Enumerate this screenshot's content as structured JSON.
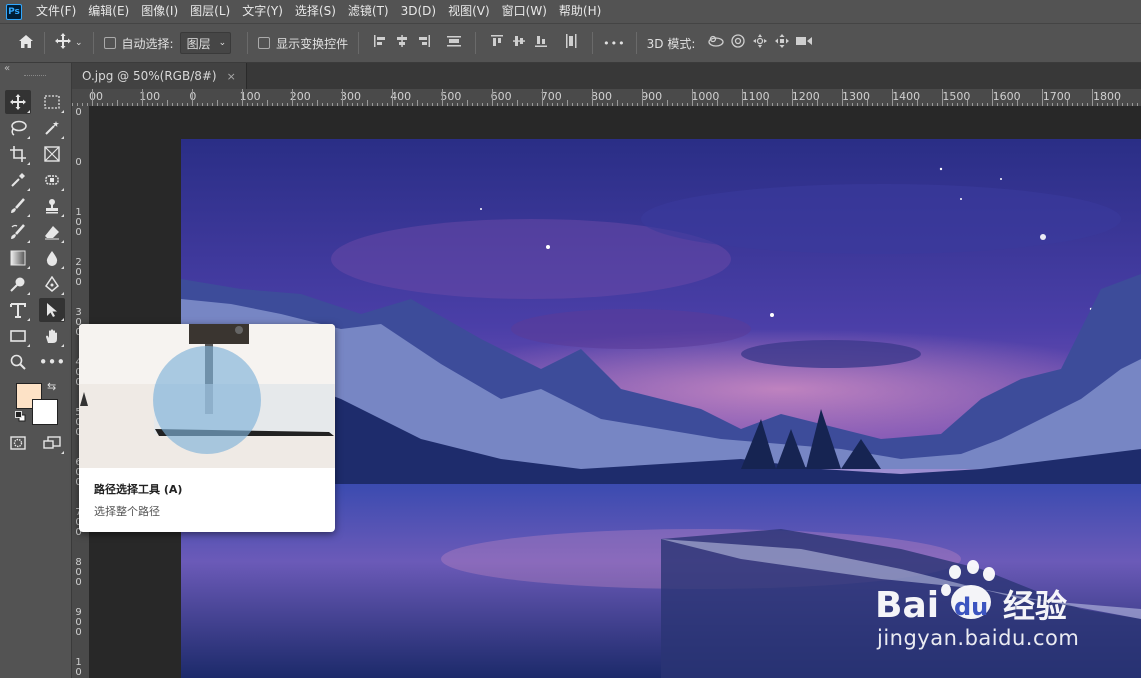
{
  "app": {
    "logo_text": "Ps"
  },
  "menu": [
    "文件(F)",
    "编辑(E)",
    "图像(I)",
    "图层(L)",
    "文字(Y)",
    "选择(S)",
    "滤镜(T)",
    "3D(D)",
    "视图(V)",
    "窗口(W)",
    "帮助(H)"
  ],
  "options": {
    "auto_select_label": "自动选择:",
    "auto_select_target": "图层",
    "show_transform_label": "显示变换控件",
    "more_label": "•••",
    "mode_3d_label": "3D 模式:"
  },
  "document_tab": {
    "title": "O.jpg @ 50%(RGB/8#)",
    "close": "×"
  },
  "toolbox": {
    "collapse": "«",
    "more_tools": "•••"
  },
  "ruler": {
    "h_labels": [
      "00",
      "100",
      "0",
      "100",
      "200",
      "300",
      "400",
      "500",
      "600",
      "700",
      "800",
      "900",
      "1000",
      "1100",
      "1200",
      "1300",
      "1400",
      "1500",
      "1600",
      "1700",
      "1800",
      "1"
    ],
    "v_labels": [
      "0",
      "0",
      "1 0 0",
      "2 0 0",
      "3 0 0",
      "4 0 0",
      "5 0 0",
      "6 0 0",
      "7 0 0",
      "8 0 0",
      "9 0 0",
      "1 0 0"
    ]
  },
  "tooltip": {
    "title": "路径选择工具 (A)",
    "description": "选择整个路径"
  },
  "watermark": {
    "logo_text": "Bai",
    "logo_text2": "du",
    "logo_text3": "经验",
    "url": "jingyan.baidu.com"
  },
  "colors": {
    "foreground": "#fde2c6",
    "background": "#ffffff",
    "accent": "#31a8ff"
  }
}
